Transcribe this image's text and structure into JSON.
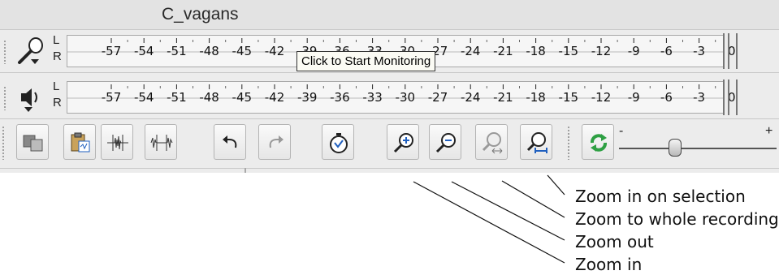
{
  "window": {
    "title": "C_vagans"
  },
  "meters": {
    "channel_left": "L",
    "channel_right": "R",
    "db_ticks": [
      "-57",
      "-54",
      "-51",
      "-48",
      "-45",
      "-42",
      "-39",
      "-36",
      "-33",
      "-30",
      "-27",
      "-24",
      "-21",
      "-18",
      "-15",
      "-12",
      "-9",
      "-6",
      "-3",
      "0"
    ],
    "recording": {
      "icon": "microphone-icon"
    },
    "playback": {
      "icon": "speaker-icon"
    },
    "tooltip": "Click to Start Monitoring"
  },
  "toolbar": {
    "buttons": [
      {
        "name": "copy-button",
        "icon": "copy-icon"
      },
      {
        "name": "paste-button",
        "icon": "paste-icon"
      },
      {
        "name": "trim-button",
        "icon": "trim-audio-icon"
      },
      {
        "name": "silence-button",
        "icon": "silence-audio-icon"
      },
      {
        "name": "undo-button",
        "icon": "undo-icon"
      },
      {
        "name": "redo-button",
        "icon": "redo-icon"
      },
      {
        "name": "sync-lock-button",
        "icon": "stopwatch-icon"
      },
      {
        "name": "zoom-in-button",
        "icon": "zoom-in-icon"
      },
      {
        "name": "zoom-out-button",
        "icon": "zoom-out-icon"
      },
      {
        "name": "zoom-fit-button",
        "icon": "zoom-fit-icon"
      },
      {
        "name": "zoom-selection-button",
        "icon": "zoom-selection-icon"
      },
      {
        "name": "transcription-play-button",
        "icon": "green-arrows-icon"
      }
    ],
    "play_speed": {
      "minus": "-",
      "plus": "+",
      "value": 0.34
    }
  },
  "callouts": {
    "zoom_in_on_selection": "Zoom in on selection",
    "zoom_to_whole_recording": "Zoom to whole recording",
    "zoom_out": "Zoom out",
    "zoom_in": "Zoom in"
  },
  "colors": {
    "toolbar_bg": "#ececec",
    "zoom_icon_accent": "#1f5fbf",
    "play_arrows": "#2ea043"
  }
}
